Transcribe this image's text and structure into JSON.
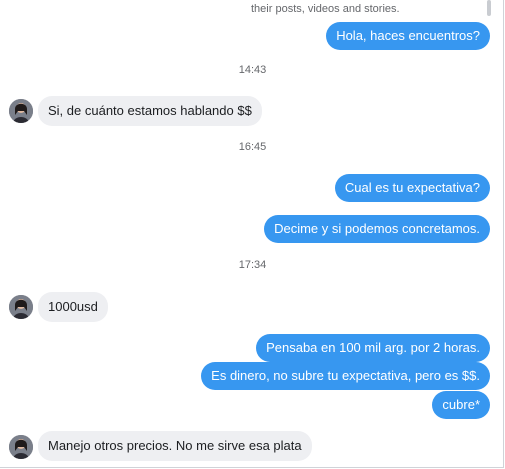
{
  "header": {
    "truncated_text": "their posts, videos and stories."
  },
  "messages": [
    {
      "side": "out",
      "text": "Hola, haces encuentros?"
    },
    {
      "type": "time",
      "text": "14:43"
    },
    {
      "side": "in",
      "text": "Si, de cuánto estamos hablando $$"
    },
    {
      "type": "time",
      "text": "16:45"
    },
    {
      "side": "out",
      "text": "Cual es tu expectativa?"
    },
    {
      "side": "out",
      "text": "Decime y si podemos concretamos."
    },
    {
      "type": "time",
      "text": "17:34"
    },
    {
      "side": "in",
      "text": "1000usd"
    },
    {
      "side": "out",
      "text": "Pensaba en 100 mil arg. por 2 horas."
    },
    {
      "side": "out",
      "text": "Es dinero, no subre tu expectativa, pero es $$."
    },
    {
      "side": "out",
      "text": "cubre*"
    },
    {
      "side": "in",
      "text": "Manejo otros precios. No me sirve esa plata"
    }
  ],
  "colors": {
    "outgoing_bubble": "#3797f0",
    "incoming_bubble": "#eeeff2",
    "timestamp": "#65676b"
  },
  "icons": {
    "avatar": "contact-avatar-icon"
  }
}
